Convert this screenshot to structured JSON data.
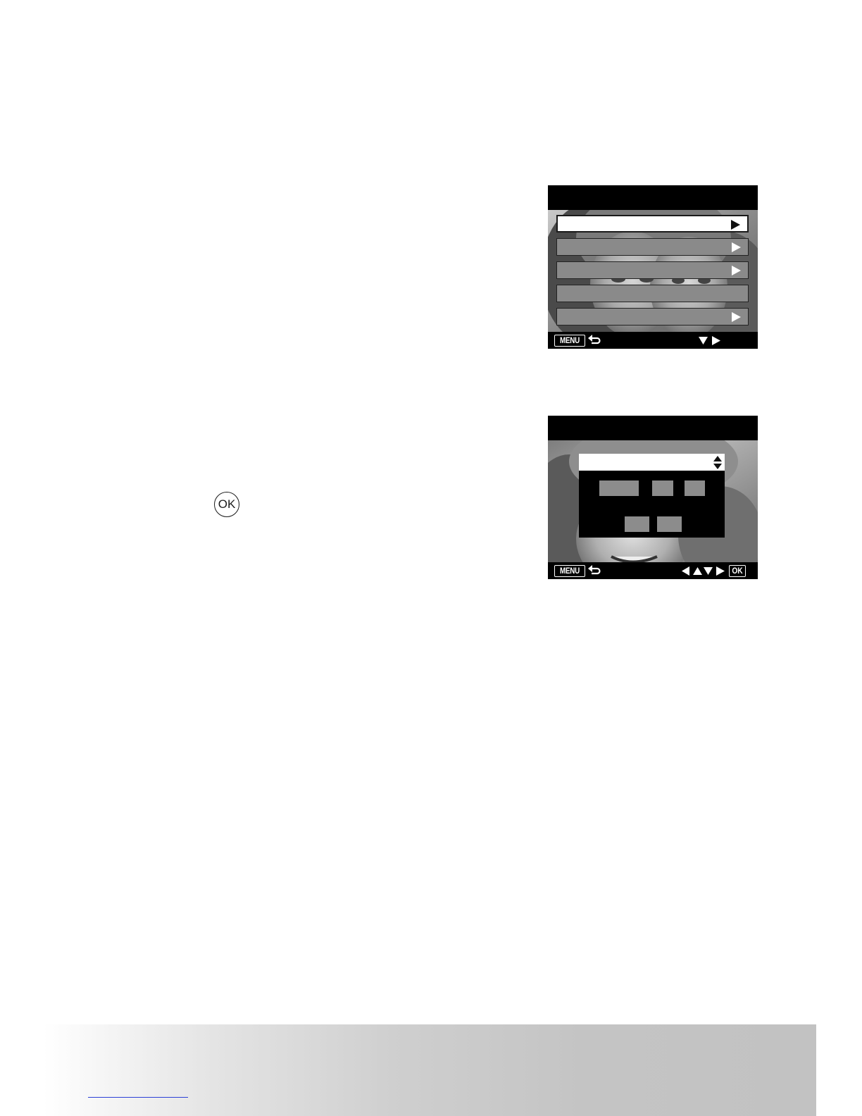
{
  "ok_button": {
    "label": "OK"
  },
  "screen1": {
    "menu_key_label": "MENU",
    "menu_rows": [
      {
        "selected": true,
        "has_arrow": true
      },
      {
        "selected": false,
        "has_arrow": true
      },
      {
        "selected": false,
        "has_arrow": true
      },
      {
        "selected": false,
        "has_arrow": false
      },
      {
        "selected": false,
        "has_arrow": true
      }
    ],
    "nav_icons": [
      "down-arrow-icon",
      "right-arrow-icon"
    ]
  },
  "screen2": {
    "menu_key_label": "MENU",
    "ok_key_label": "OK",
    "nav_icons": [
      "left-arrow-icon",
      "up-arrow-icon",
      "down-arrow-icon",
      "right-arrow-icon"
    ]
  },
  "colors": {
    "screen_bg": "#000000",
    "menu_row_gray": "#8a8a8a",
    "footer_gray": "#c2c2c2",
    "link_blue": "#2a3fd6"
  }
}
